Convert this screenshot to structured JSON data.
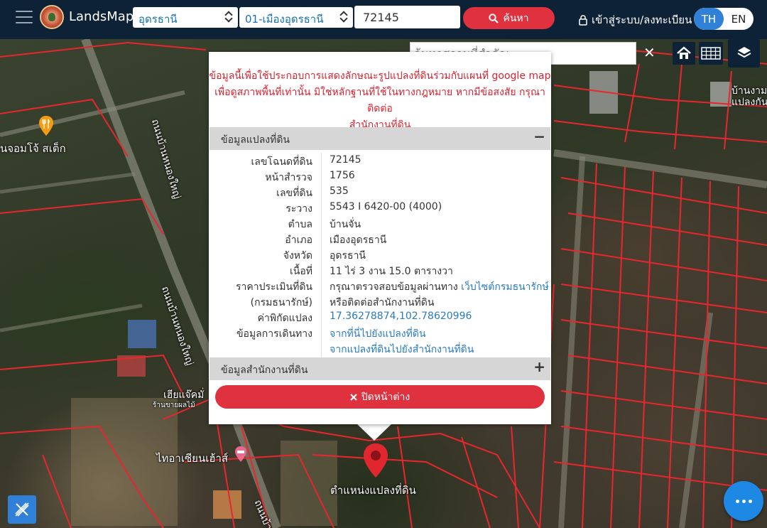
{
  "header": {
    "brand": "LandsMaps",
    "province_select": "อุดรธานี",
    "district_select": "01-เมืองอุดรธานี",
    "parcel_input": "72145",
    "search_label": "ค้นหา",
    "login_label": "เข้าสู่ระบบ/ลงทะเบียน",
    "lang_th": "TH",
    "lang_en": "EN"
  },
  "map": {
    "place_search_placeholder": "ค้นหาสถานที่สำคัญ",
    "labels": {
      "road_a": "ถนนบ้านหนองใหญ่",
      "road_b": "ถนนบ้านหนองใหญ่",
      "road_c": "ถนนบ้าน",
      "poi_cafe": "นจอมโจ้ สเต็ก",
      "poi_shop": "เฮียแจ๊คมั่",
      "poi_shop_sub": "ร้านขายผลไม้",
      "poi_hotel": "ไทอาเซียนเฮ้าส์",
      "village_ne": "บ้านงาม",
      "village_ne2": "แปลงกัน",
      "marker_label": "ตำแหน่งแปลงที่ดิน"
    }
  },
  "popup": {
    "notice_lines": [
      "ข้อมูลนี้เพื่อใช้ประกอบการแสดงลักษณะรูปแปลงที่ดินร่วมกับแผนที่ google map",
      "เพื่อดูสภาพพื้นที่เท่านั้น มิใช่หลักฐานที่ใช้ในทางกฎหมาย หากมีข้อสงสัย กรุณาติดต่อ",
      "สำนักงานที่ดิน"
    ],
    "section_parcel": "ข้อมูลแปลงที่ดิน",
    "section_parcel_toggle": "−",
    "rows": [
      {
        "key": "เลขโฉนดที่ดิน",
        "value": "72145"
      },
      {
        "key": "หน้าสำรวจ",
        "value": "1756"
      },
      {
        "key": "เลขที่ดิน",
        "value": "535"
      },
      {
        "key": "ระวาง",
        "value": "5543 I 6420-00 (4000)"
      },
      {
        "key": "ตำบล",
        "value": "บ้านจั่น"
      },
      {
        "key": "อำเภอ",
        "value": "เมืองอุดรธานี"
      },
      {
        "key": "จังหวัด",
        "value": "อุดรธานี"
      },
      {
        "key": "เนื้อที่",
        "value": "11 ไร่ 3 งาน 15.0 ตารางวา"
      },
      {
        "key": "ราคาประเมินที่ดิน",
        "value": "กรุณาตรวจสอบข้อมูลผ่านทาง",
        "link": "เว็บไซต์กรมธนารักษ์"
      },
      {
        "key": "(กรมธนารักษ์)",
        "value": "หรือติดต่อสำนักงานที่ดิน"
      },
      {
        "key": "ค่าพิกัดแปลง",
        "link": "17.36278874,102.78620996"
      },
      {
        "key": "ข้อมูลการเดินทาง",
        "link": "จากที่นี่ไปยังแปลงที่ดิน"
      },
      {
        "key": "",
        "link": "จากแปลงที่ดินไปยังสำนักงานที่ดิน"
      }
    ],
    "section_office": "ข้อมูลสำนักงานที่ดิน",
    "section_office_toggle": "+",
    "close_label": "ปิดหน้าต่าง"
  },
  "colors": {
    "header_bg": "#0d2137",
    "accent_red": "#e0313e",
    "accent_blue": "#2f80d6",
    "notice_red": "#d9232e",
    "parcel_lines": "#e8262e",
    "link_blue": "#2a7bc0"
  },
  "icons": [
    "hamburger-icon",
    "logo-icon",
    "search-icon",
    "lock-icon",
    "close-icon",
    "home-icon",
    "grid-icon",
    "layers-icon",
    "times-icon",
    "map-pin-icon",
    "tool-icon",
    "more-icon",
    "food-icon",
    "hotel-icon"
  ]
}
